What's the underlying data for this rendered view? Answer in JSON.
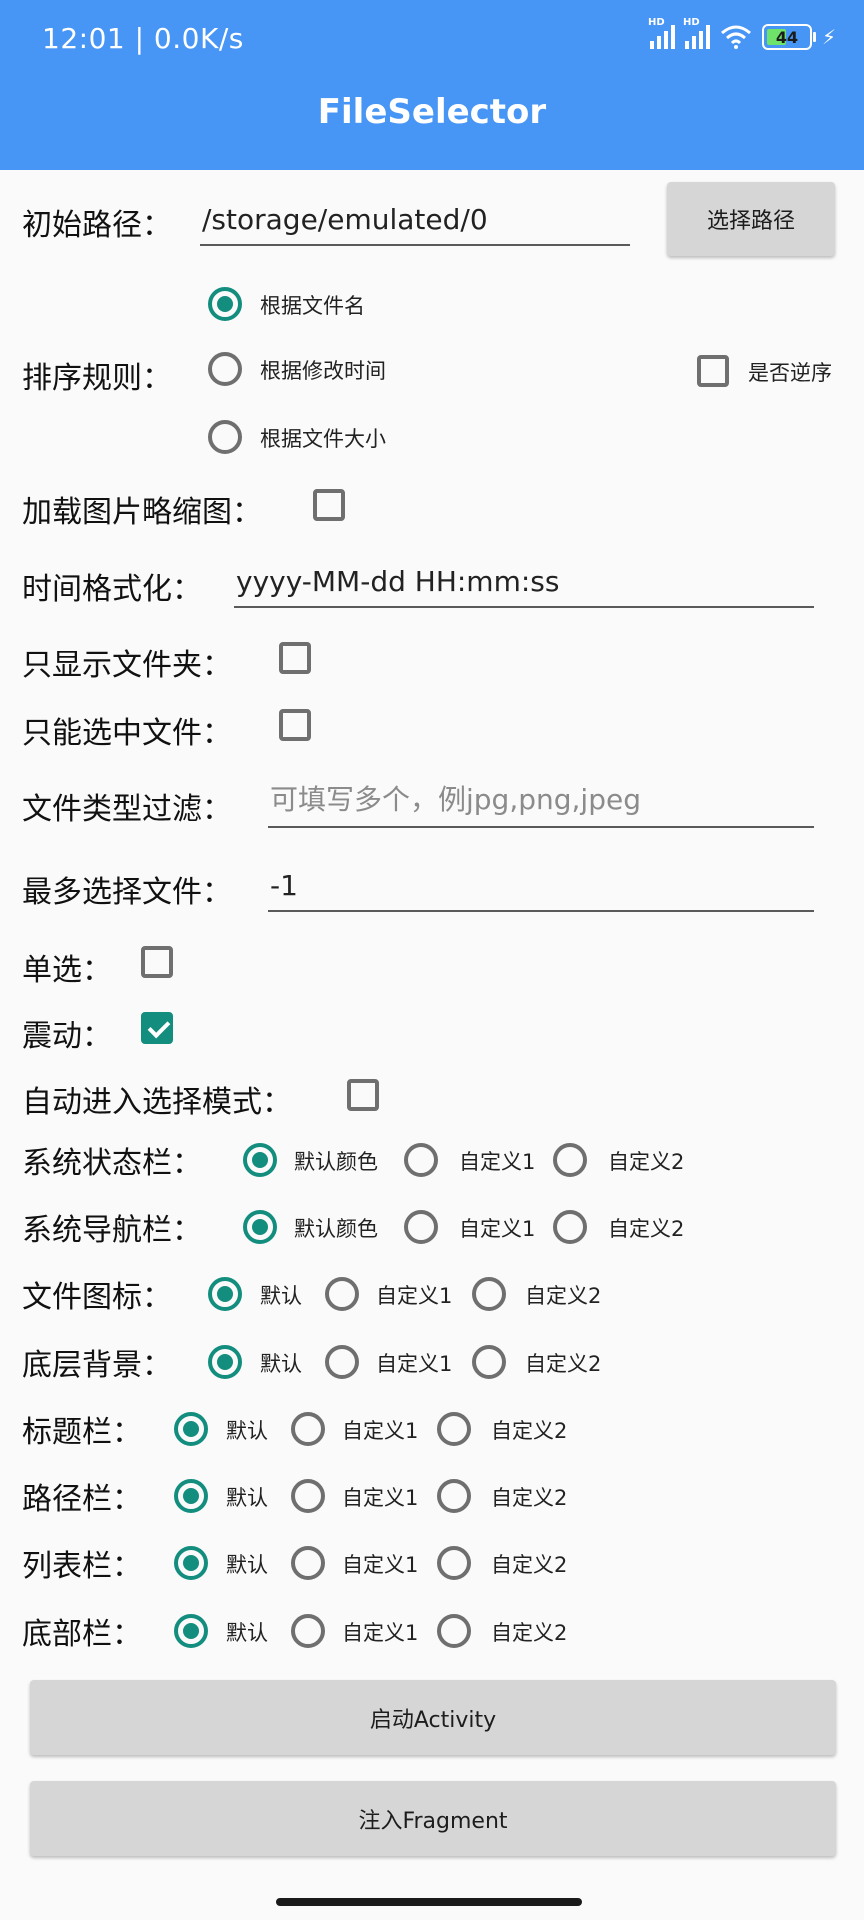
{
  "status_bar": {
    "time": "12:01 | 0.0K/s",
    "signal1_label": "HD",
    "signal2_label": "HD",
    "battery_level": "44"
  },
  "app": {
    "title": "FileSelector"
  },
  "initial_path": {
    "label": "初始路径：",
    "value": "/storage/emulated/0",
    "button": "选择路径"
  },
  "sort": {
    "label": "排序规则：",
    "options": [
      "根据文件名",
      "根据修改时间",
      "根据文件大小"
    ],
    "selected": "根据文件名",
    "reverse_label": "是否逆序",
    "reverse_checked": false
  },
  "thumbnail": {
    "label": "加载图片略缩图：",
    "checked": false
  },
  "time_format": {
    "label": "时间格式化：",
    "value": "yyyy-MM-dd HH:mm:ss"
  },
  "only_folders": {
    "label": "只显示文件夹：",
    "checked": false
  },
  "only_files": {
    "label": "只能选中文件：",
    "checked": false
  },
  "file_filter": {
    "label": "文件类型过滤：",
    "placeholder": "可填写多个，例jpg,png,jpeg",
    "value": ""
  },
  "max_select": {
    "label": "最多选择文件：",
    "value": "-1"
  },
  "single": {
    "label": "单选：",
    "checked": false
  },
  "vibrate": {
    "label": "震动：",
    "checked": true
  },
  "auto_select_mode": {
    "label": "自动进入选择模式：",
    "checked": false
  },
  "option_groups": [
    {
      "label": "系统状态栏：",
      "options": [
        "默认颜色",
        "自定义1",
        "自定义2"
      ],
      "selected": 0
    },
    {
      "label": "系统导航栏：",
      "options": [
        "默认颜色",
        "自定义1",
        "自定义2"
      ],
      "selected": 0
    },
    {
      "label": "文件图标：",
      "options": [
        "默认",
        "自定义1",
        "自定义2"
      ],
      "selected": 0
    },
    {
      "label": "底层背景：",
      "options": [
        "默认",
        "自定义1",
        "自定义2"
      ],
      "selected": 0
    },
    {
      "label": "标题栏：",
      "options": [
        "默认",
        "自定义1",
        "自定义2"
      ],
      "selected": 0
    },
    {
      "label": "路径栏：",
      "options": [
        "默认",
        "自定义1",
        "自定义2"
      ],
      "selected": 0
    },
    {
      "label": "列表栏：",
      "options": [
        "默认",
        "自定义1",
        "自定义2"
      ],
      "selected": 0
    },
    {
      "label": "底部栏：",
      "options": [
        "默认",
        "自定义1",
        "自定义2"
      ],
      "selected": 0
    }
  ],
  "actions": {
    "start_activity": "启动Activity",
    "inject_fragment": "注入Fragment"
  },
  "colors": {
    "app_bar": "#4795F4",
    "accent": "#138E7E",
    "background": "#FAFAFA",
    "button": "#D6D6D6"
  }
}
